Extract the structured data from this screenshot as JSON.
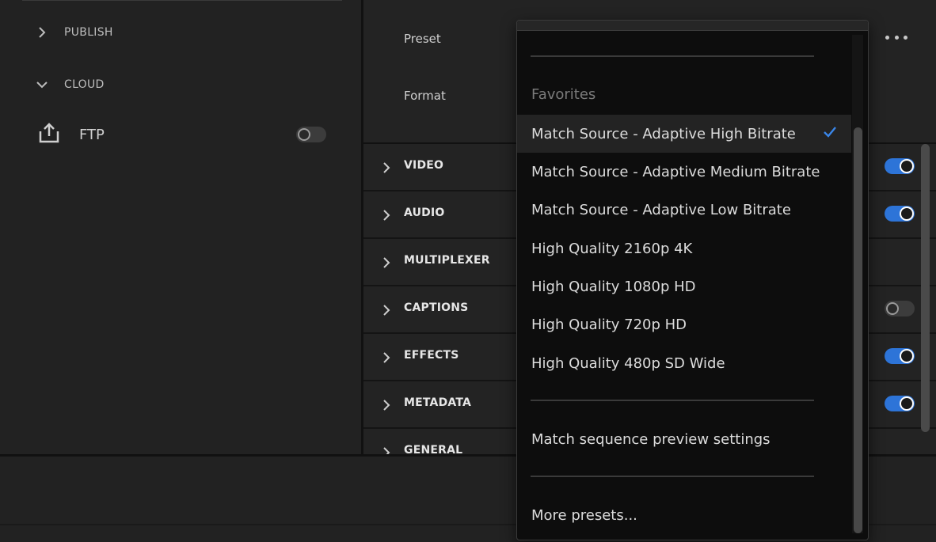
{
  "sidebar": {
    "items": [
      {
        "label": "PUBLISH",
        "expanded": false
      },
      {
        "label": "CLOUD",
        "expanded": true
      }
    ],
    "ftp": {
      "label": "FTP",
      "enabled": false,
      "icon": "upload-icon"
    }
  },
  "settings": {
    "preset_label": "Preset",
    "format_label": "Format",
    "more_icon": "more-horizontal-icon"
  },
  "sections": [
    {
      "label": "VIDEO",
      "toggle": "on"
    },
    {
      "label": "AUDIO",
      "toggle": "on"
    },
    {
      "label": "MULTIPLEXER",
      "toggle": "none"
    },
    {
      "label": "CAPTIONS",
      "toggle": "off"
    },
    {
      "label": "EFFECTS",
      "toggle": "on"
    },
    {
      "label": "METADATA",
      "toggle": "on"
    },
    {
      "label": "GENERAL",
      "toggle": "none"
    }
  ],
  "preset_dropdown": {
    "favorites_header": "Favorites",
    "items": [
      "Match Source - Adaptive High Bitrate",
      "Match Source - Adaptive Medium Bitrate",
      "Match Source - Adaptive Low Bitrate",
      "High Quality 2160p 4K",
      "High Quality 1080p HD",
      "High Quality 720p HD",
      "High Quality 480p SD Wide"
    ],
    "selected": "Match Source - Adaptive High Bitrate",
    "match_sequence": "Match sequence preview settings",
    "more_presets": "More presets..."
  },
  "colors": {
    "accent": "#2d74d8",
    "background": "#232323",
    "dropdown_bg": "#0d0d0d"
  }
}
